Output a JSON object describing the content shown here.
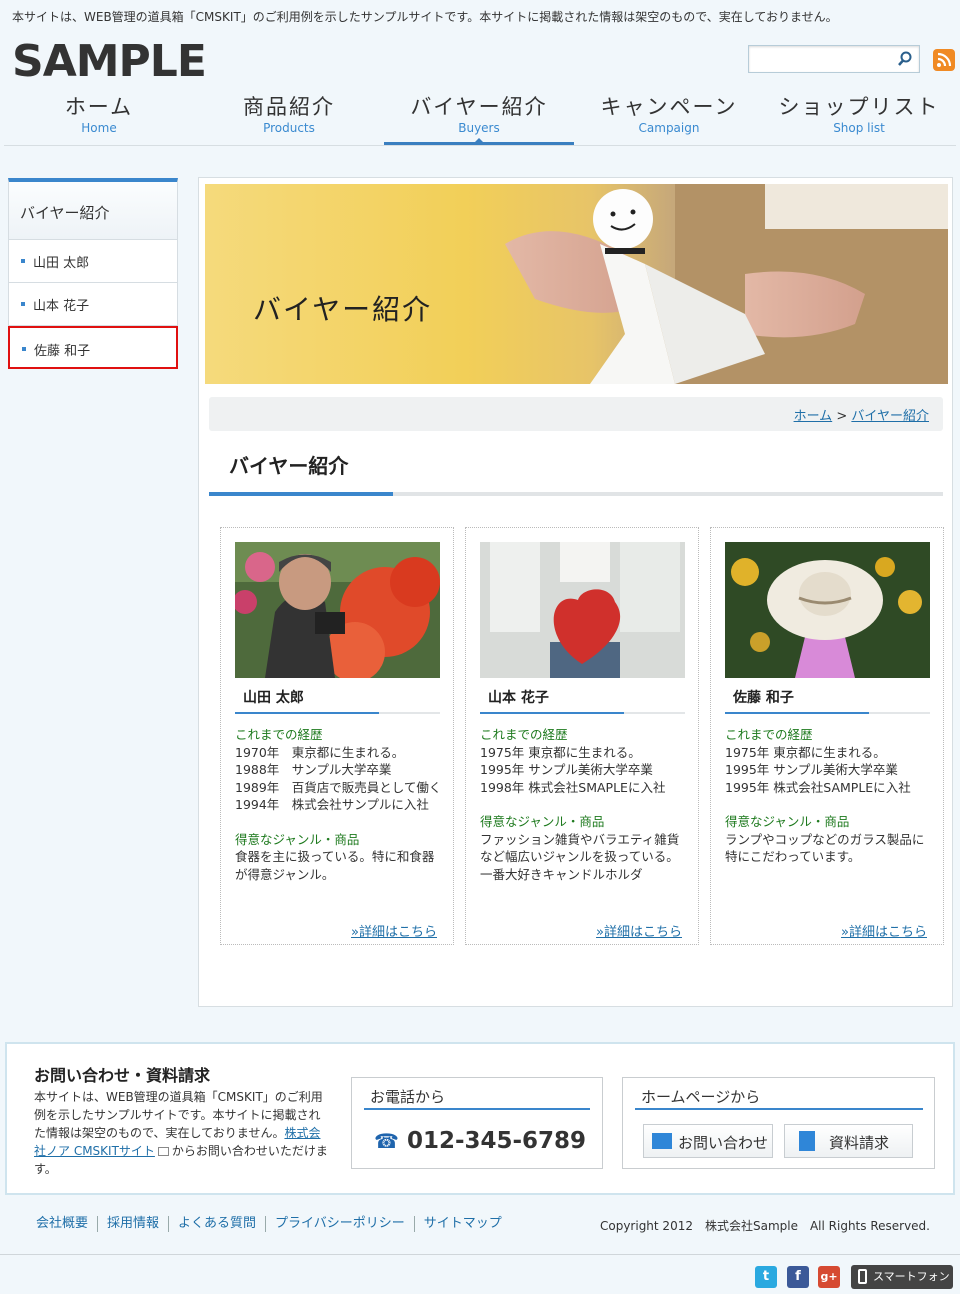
{
  "header": {
    "notice": "本サイトは、WEB管理の道具箱「CMSKIT」のご利用例を示したサンプルサイトです。本サイトに掲載された情報は架空のもので、実在しておりません。",
    "logo": "SAMPLE",
    "search_value": ""
  },
  "nav": [
    {
      "ja": "ホーム",
      "en": "Home"
    },
    {
      "ja": "商品紹介",
      "en": "Products"
    },
    {
      "ja": "バイヤー紹介",
      "en": "Buyers"
    },
    {
      "ja": "キャンペーン",
      "en": "Campaign"
    },
    {
      "ja": "ショップリスト",
      "en": "Shop list"
    }
  ],
  "sidebar": {
    "title": "バイヤー紹介",
    "items": [
      "山田 太郎",
      "山本 花子",
      "佐藤 和子"
    ]
  },
  "main": {
    "hero_title": "バイヤー紹介",
    "breadcrumb": {
      "home": "ホーム",
      "sep": ">",
      "current": "バイヤー紹介"
    },
    "page_title": "バイヤー紹介",
    "cards": [
      {
        "name": "山田 太郎",
        "career_label": "これまでの経歴",
        "career": [
          "1970年　東京都に生まれる。",
          "1988年　サンプル大学卒業",
          "1989年　百貨店で販売員として働く",
          "1994年　株式会社サンプルに入社"
        ],
        "genre_label": "得意なジャンル・商品",
        "genre": "食器を主に扱っている。特に和食器が得意ジャンル。",
        "more": "»詳細はこちら"
      },
      {
        "name": "山本 花子",
        "career_label": "これまでの経歴",
        "career": [
          "1975年 東京都に生まれる。",
          "1995年 サンプル美術大学卒業",
          "1998年 株式会社SMAPLEに入社"
        ],
        "genre_label": "得意なジャンル・商品",
        "genre": "ファッション雑貨やバラエティ雑貨など幅広いジャンルを扱っている。一番大好きキャンドルホルダ",
        "more": "»詳細はこちら"
      },
      {
        "name": "佐藤 和子",
        "career_label": "これまでの経歴",
        "career": [
          "1975年 東京都に生まれる。",
          "1995年 サンプル美術大学卒業",
          "1995年 株式会社SAMPLEに入社"
        ],
        "genre_label": "得意なジャンル・商品",
        "genre": "ランプやコップなどのガラス製品に特にこだわっています。",
        "more": "»詳細はこちら"
      }
    ]
  },
  "contact": {
    "title": "お問い合わせ・資料請求",
    "text_before": "本サイトは、WEB管理の道具箱「CMSKIT」のご利用例を示したサンプルサイトです。本サイトに掲載された情報は架空のもので、実在しておりません。",
    "link": "株式会社ノア CMSKITサイト",
    "text_after": "からお問い合わせいただけます。",
    "phone_label": "お電話から",
    "phone": "012-345-6789",
    "web_label": "ホームページから",
    "inquiry": "お問い合わせ",
    "request": "資料請求"
  },
  "footer": {
    "links": [
      "会社概要",
      "採用情報",
      "よくある質問",
      "プライバシーポリシー",
      "サイトマップ"
    ],
    "copyright": "Copyright 2012　株式会社Sample　All Rights Reserved.",
    "smartphone": "スマートフォン"
  },
  "colors": {
    "accent": "#3a86cc",
    "highlight": "#e01010",
    "genre_label": "#1e7a1e"
  }
}
